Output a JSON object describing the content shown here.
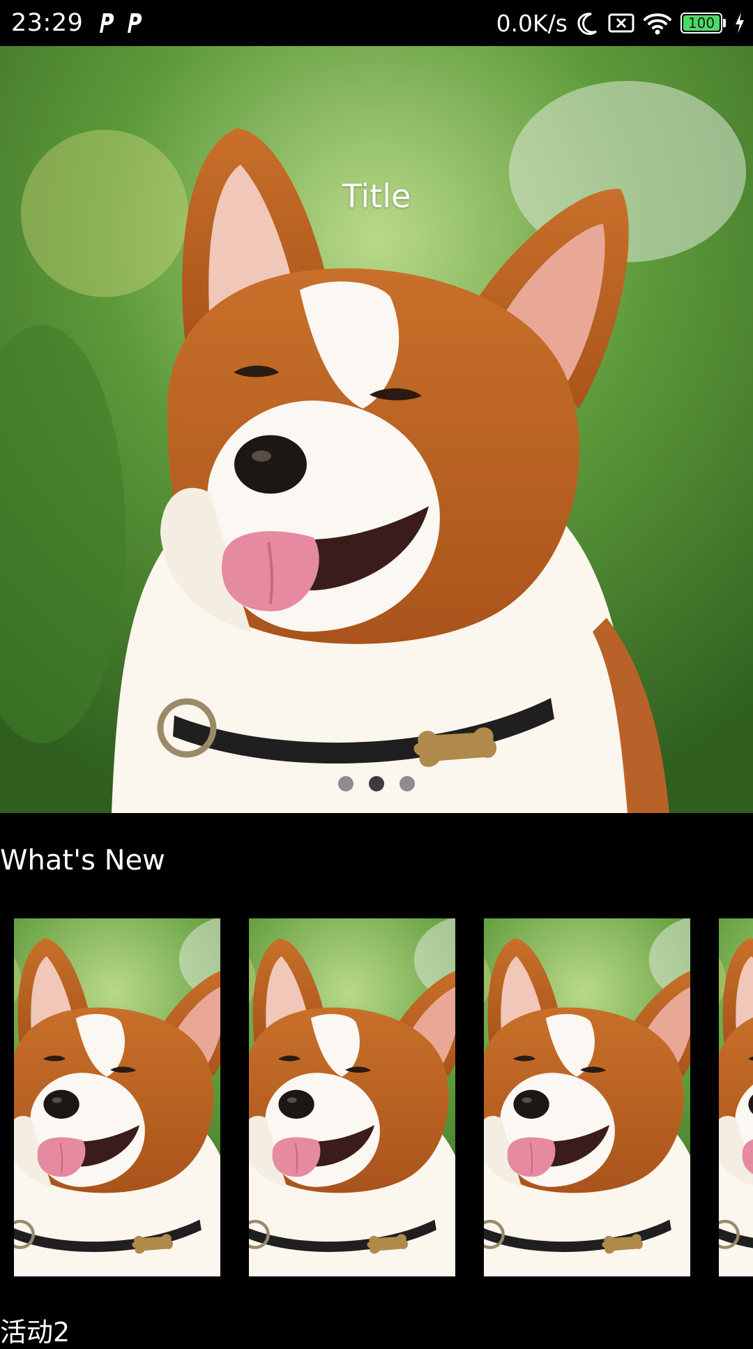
{
  "status_bar": {
    "time": "23:29",
    "net_speed": "0.0K/s",
    "battery_level": "100",
    "icons": [
      "p-app-icon",
      "p-app-icon",
      "moon-icon",
      "sim-off-icon",
      "wifi-icon",
      "battery-icon",
      "charging-icon"
    ]
  },
  "hero": {
    "title": "Title",
    "image": "corgi-photo",
    "page_count": 3,
    "active_page": 2
  },
  "section": {
    "title": "What's New"
  },
  "cards": [
    {
      "image": "corgi-photo"
    },
    {
      "image": "corgi-photo"
    },
    {
      "image": "corgi-photo"
    },
    {
      "image": "corgi-photo"
    }
  ],
  "activity": {
    "label": "活动2"
  },
  "colors": {
    "background": "#000000",
    "text": "#ffffff",
    "battery_fill": "#4cd964",
    "dot_inactive": "#8c8c8c",
    "dot_active": "#3c3c3c"
  }
}
